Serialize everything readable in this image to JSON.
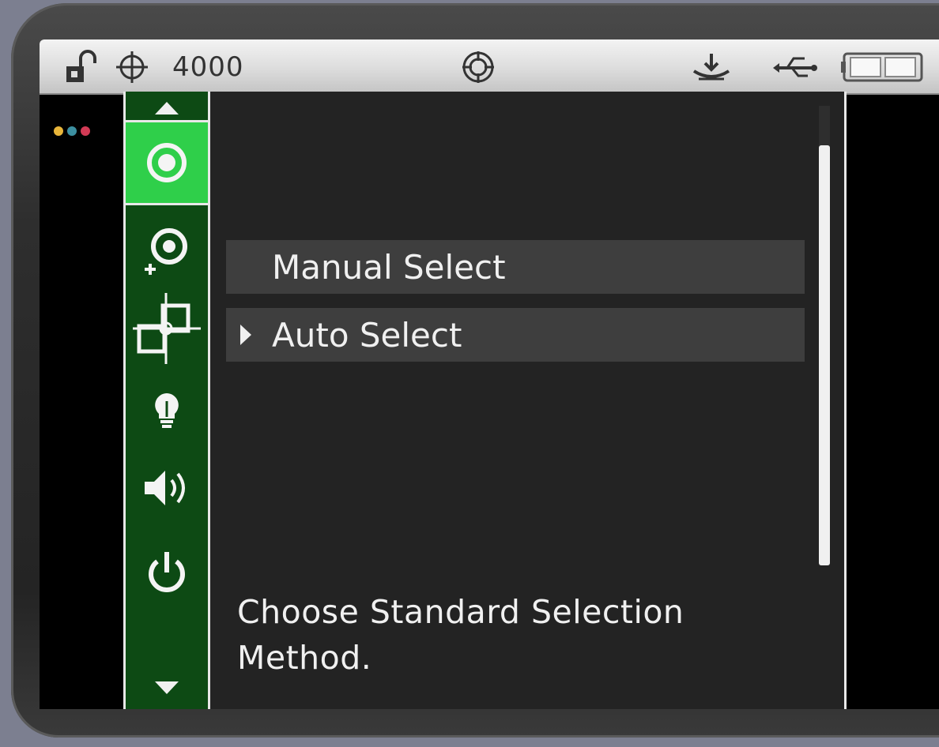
{
  "statusbar": {
    "lock_icon": "unlock-icon",
    "crosshair_icon": "crosshair-icon",
    "value": "4000",
    "target_icon": "target-icon",
    "ground_icon": "ground-icon",
    "usb_icon": "usb-icon",
    "battery_icon": "battery-icon"
  },
  "indicator_dots": {
    "colors": [
      "#e8b53a",
      "#3c8fa0",
      "#d23a55"
    ]
  },
  "sidebar": {
    "up_arrow_icon": "chevron-up-icon",
    "down_arrow_icon": "chevron-down-icon",
    "items": [
      {
        "icon": "target-circle-icon",
        "active": true
      },
      {
        "icon": "add-target-icon",
        "active": false
      },
      {
        "icon": "crosshair-squares-icon",
        "active": false
      },
      {
        "icon": "lightbulb-icon",
        "active": false
      },
      {
        "icon": "speaker-icon",
        "active": false
      },
      {
        "icon": "power-icon",
        "active": false
      }
    ],
    "accent": "#2fcf4a",
    "background": "#0d4a14"
  },
  "menu": {
    "items": [
      {
        "label": "Manual Select",
        "selected": false
      },
      {
        "label": "Auto Select",
        "selected": true
      }
    ],
    "help_text": "Choose Standard Selection Method."
  }
}
